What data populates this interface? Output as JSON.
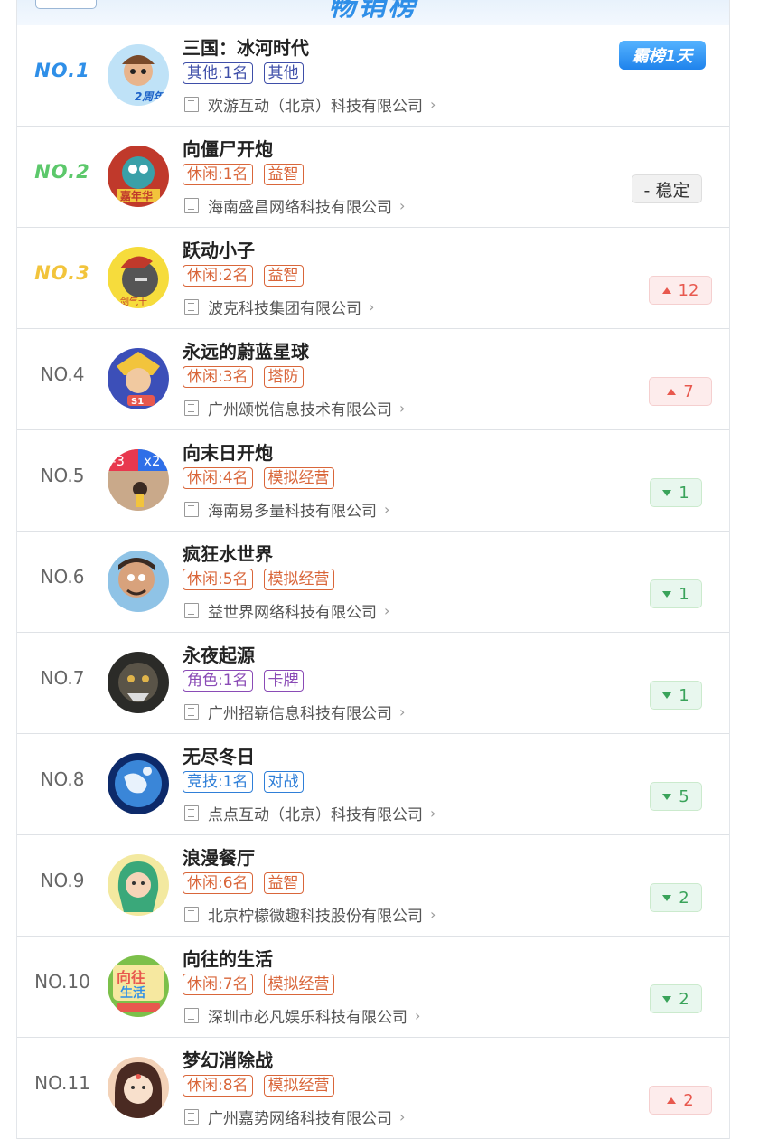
{
  "header": {
    "title": "畅销榜"
  },
  "colors": {
    "rank1": "#2f8fe8",
    "rank2": "#5cc86b",
    "rank3": "#f2c43c",
    "tag_leisure": "#d9663a",
    "tag_other": "#3e4ea8",
    "tag_role": "#8a4bb6",
    "tag_sport": "#2f7fd8"
  },
  "items": [
    {
      "rank": "NO.1",
      "name": "三国：冰河时代",
      "tags": [
        "其他:1名",
        "其他"
      ],
      "company": "欢游互动（北京）科技有限公司",
      "trend": "霸榜1天",
      "trend_type": "top",
      "icon": "game-icon-sanguo"
    },
    {
      "rank": "NO.2",
      "name": "向僵尸开炮",
      "tags": [
        "休闲:1名",
        "益智"
      ],
      "company": "海南盛昌网络科技有限公司",
      "trend": "- 稳定",
      "trend_type": "stable",
      "icon": "game-icon-zombie"
    },
    {
      "rank": "NO.3",
      "name": "跃动小子",
      "tags": [
        "休闲:2名",
        "益智"
      ],
      "company": "波克科技集团有限公司",
      "trend": "12",
      "trend_type": "up",
      "icon": "game-icon-warrior"
    },
    {
      "rank": "NO.4",
      "name": "永远的蔚蓝星球",
      "tags": [
        "休闲:3名",
        "塔防"
      ],
      "company": "广州颂悦信息技术有限公司",
      "trend": "7",
      "trend_type": "up",
      "icon": "game-icon-hero"
    },
    {
      "rank": "NO.5",
      "name": "向末日开炮",
      "tags": [
        "休闲:4名",
        "模拟经营"
      ],
      "company": "海南易多量科技有限公司",
      "trend": "1",
      "trend_type": "down",
      "icon": "game-icon-doomsday"
    },
    {
      "rank": "NO.6",
      "name": "疯狂水世界",
      "tags": [
        "休闲:5名",
        "模拟经营"
      ],
      "company": "益世界网络科技有限公司",
      "trend": "1",
      "trend_type": "down",
      "icon": "game-icon-pirate"
    },
    {
      "rank": "NO.7",
      "name": "永夜起源",
      "tags": [
        "角色:1名",
        "卡牌"
      ],
      "company": "广州招崭信息科技有限公司",
      "trend": "1",
      "trend_type": "down",
      "icon": "game-icon-beast"
    },
    {
      "rank": "NO.8",
      "name": "无尽冬日",
      "tags": [
        "竞技:1名",
        "对战"
      ],
      "company": "点点互动（北京）科技有限公司",
      "trend": "5",
      "trend_type": "down",
      "icon": "game-icon-globe"
    },
    {
      "rank": "NO.9",
      "name": "浪漫餐厅",
      "tags": [
        "休闲:6名",
        "益智"
      ],
      "company": "北京柠檬微趣科技股份有限公司",
      "trend": "2",
      "trend_type": "down",
      "icon": "game-icon-girl"
    },
    {
      "rank": "NO.10",
      "name": "向往的生活",
      "tags": [
        "休闲:7名",
        "模拟经营"
      ],
      "company": "深圳市必凡娱乐科技有限公司",
      "trend": "2",
      "trend_type": "down",
      "icon": "game-icon-life"
    },
    {
      "rank": "NO.11",
      "name": "梦幻消除战",
      "tags": [
        "休闲:8名",
        "模拟经营"
      ],
      "company": "广州嘉势网络科技有限公司",
      "trend": "2",
      "trend_type": "up",
      "icon": "game-icon-princess"
    }
  ]
}
